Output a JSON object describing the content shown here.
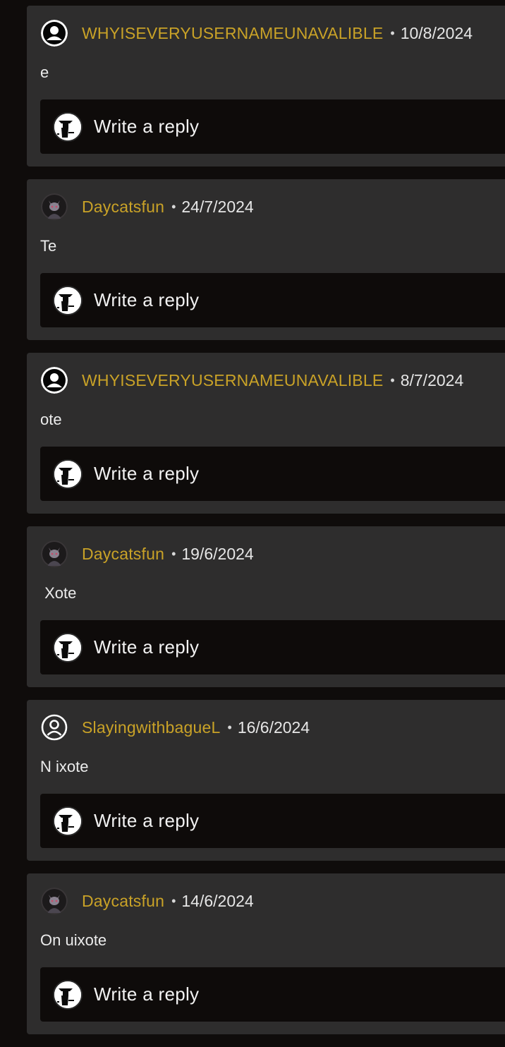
{
  "reply": {
    "placeholder": "Write a reply",
    "avatar_icon": "user-ninja-avatar-icon"
  },
  "colors": {
    "background": "#0f0c0b",
    "card": "#2e2d2d",
    "reply_box": "#0e0b0a",
    "username": "#c9a227",
    "text": "#ececec"
  },
  "separator": "•",
  "comments": [
    {
      "username": "WHYISEVERYUSERNAMEUNAVALIBLE",
      "date": "10/8/2024",
      "body": "e",
      "avatar": "black-silhouette-avatar"
    },
    {
      "username": "Daycatsfun",
      "date": "24/7/2024",
      "body": "Te",
      "avatar": "cat-character-avatar"
    },
    {
      "username": "WHYISEVERYUSERNAMEUNAVALIBLE",
      "date": "8/7/2024",
      "body": "ote",
      "avatar": "black-silhouette-avatar"
    },
    {
      "username": "Daycatsfun",
      "date": "19/6/2024",
      "body": " Xote",
      "avatar": "cat-character-avatar"
    },
    {
      "username": "SlayingwithbagueL",
      "date": "16/6/2024",
      "body": "N ixote",
      "avatar": "default-user-outline-avatar"
    },
    {
      "username": "Daycatsfun",
      "date": "14/6/2024",
      "body": "On uixote",
      "avatar": "cat-character-avatar"
    }
  ]
}
